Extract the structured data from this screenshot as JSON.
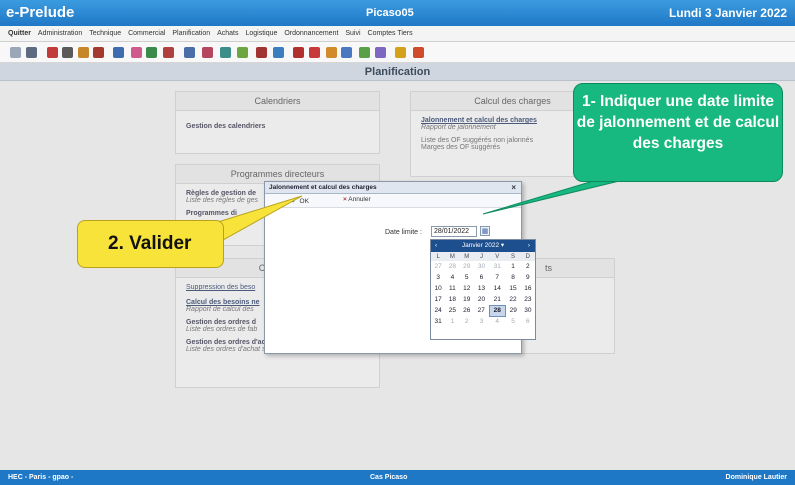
{
  "titlebar": {
    "app": "e-Prelude",
    "center": "Picaso05",
    "date": "Lundi 3 Janvier 2022"
  },
  "menu": [
    "Quitter",
    "Administration",
    "Technique",
    "Commercial",
    "Planification",
    "Achats",
    "Logistique",
    "Ordonnancement",
    "Suivi",
    "Comptes Tiers"
  ],
  "section_title": "Planification",
  "panels": {
    "calendriers": {
      "title": "Calendriers",
      "item": "Gestion des calendriers"
    },
    "charges": {
      "title": "Calcul des charges",
      "link": "Jalonnement et calcul des charges",
      "link_sub": "Rapport de jalonnement",
      "item1": "Liste des OF suggérés non jalonnés",
      "item2": "Marges des OF suggérés"
    },
    "programmes": {
      "title": "Programmes directeurs",
      "link1": "Règles de gestion de",
      "link1_sub": "Liste des règles de ges",
      "link2": "Programmes di"
    },
    "besoins": {
      "title": "Calcul de",
      "link1": "Suppression des beso",
      "link2": "Calcul des besoins ne",
      "link2_sub": "Rapport de calcul des",
      "link3": "Gestion des ordres d",
      "link3_sub": "Liste des ordres de fab",
      "link4": "Gestion des ordres d'achat suggérés",
      "link4_sub": "Liste des ordres d'achat suggérés"
    },
    "right_lower": {
      "title": "ts"
    }
  },
  "dialog": {
    "title": "Jalonnement et calcul des charges",
    "ok": "OK",
    "cancel": "Annuler",
    "date_label": "Date limite :",
    "date_value": "28/01/2022"
  },
  "calendar": {
    "month": "Janvier 2022 ▾",
    "weekdays": [
      "L",
      "M",
      "M",
      "J",
      "V",
      "S",
      "D"
    ],
    "weeks": [
      [
        "27",
        "28",
        "29",
        "30",
        "31",
        "1",
        "2"
      ],
      [
        "3",
        "4",
        "5",
        "6",
        "7",
        "8",
        "9"
      ],
      [
        "10",
        "11",
        "12",
        "13",
        "14",
        "15",
        "16"
      ],
      [
        "17",
        "18",
        "19",
        "20",
        "21",
        "22",
        "23"
      ],
      [
        "24",
        "25",
        "26",
        "27",
        "28",
        "29",
        "30"
      ],
      [
        "31",
        "1",
        "2",
        "3",
        "4",
        "5",
        "6"
      ]
    ],
    "selected": "28"
  },
  "callouts": {
    "green": "1- Indiquer une date limite de jalonnement et de calcul des charges",
    "yellow": "2. Valider"
  },
  "statusbar": {
    "left": "HEC - Paris - gpao -",
    "center": "Cas Picaso",
    "right": "Dominique Lautier"
  },
  "colors": {
    "accent": "#1f78c6",
    "callout_green": "#17b980",
    "callout_yellow": "#f7e33a"
  }
}
